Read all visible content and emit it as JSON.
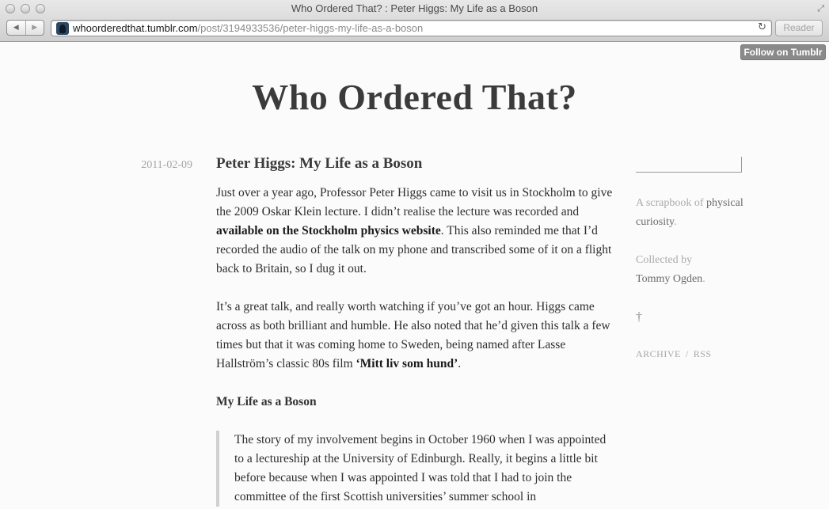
{
  "window": {
    "title": "Who Ordered That? : Peter Higgs: My Life as a Boson",
    "url_domain": "whoorderedthat.tumblr.com",
    "url_path": "/post/3194933536/peter-higgs-my-life-as-a-boson",
    "reader_label": "Reader"
  },
  "page": {
    "follow_label": "Follow on Tumblr",
    "site_title": "Who Ordered That?",
    "post": {
      "date": "2011-02-09",
      "title": "Peter Higgs: My Life as a Boson",
      "p1_a": "Just over a year ago, Professor Peter Higgs came to visit us in Stockholm to give the 2009 Oskar Klein lecture. I didn’t realise the lecture was recorded and ",
      "p1_link": "available on the Stockholm physics website",
      "p1_b": ". This also reminded me that I’d recorded the audio of the talk on my phone and transcribed some of it on a flight back to Britain, so I dug it out.",
      "p2_a": "It’s a great talk, and really worth watching if you’ve got an hour. Higgs came across as both brilliant and humble. He also noted that he’d given this talk a few times but that it was coming home to Sweden, being named after Lasse Hallström’s classic 80s film ",
      "p2_link": "‘Mitt liv som hund’",
      "p2_b": ".",
      "subheading": "My Life as a Boson",
      "quote": "The story of my involvement begins in October 1960 when I was appointed to a lectureship at the University of Edinburgh. Really, it begins a little bit before because when I was appointed I was told that I had to join the committee of the first Scottish universities’ summer school in"
    },
    "sidebar": {
      "desc_a": "A scrapbook of ",
      "desc_strong": "physical curiosity",
      "desc_b": ".",
      "collected_label": "Collected by",
      "author": "Tommy Ogden",
      "author_suffix": ".",
      "dagger": "†",
      "archive_label": "ARCHIVE",
      "separator": "/",
      "rss_label": "RSS"
    }
  }
}
